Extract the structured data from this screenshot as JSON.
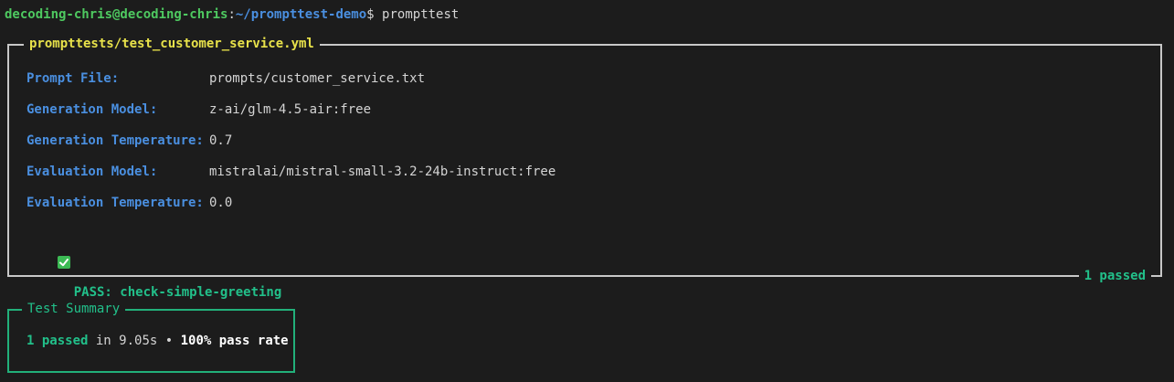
{
  "prompt": {
    "user_host": "decoding-chris@decoding-chris",
    "separator": ":",
    "path": "~/prompttest-demo",
    "symbol": "$",
    "command": "prompttest"
  },
  "test_panel": {
    "title": "prompttests/test_customer_service.yml",
    "fields": [
      {
        "label": "Prompt File:",
        "value": "prompts/customer_service.txt"
      },
      {
        "label": "Generation Model:",
        "value": "z-ai/glm-4.5-air:free"
      },
      {
        "label": "Generation Temperature:",
        "value": "0.7"
      },
      {
        "label": "Evaluation Model:",
        "value": "mistralai/mistral-small-3.2-24b-instruct:free"
      },
      {
        "label": "Evaluation Temperature:",
        "value": "0.0"
      }
    ],
    "result": {
      "icon": "check-mark-icon",
      "text": "PASS: check-simple-greeting"
    },
    "footer": "1 passed"
  },
  "summary_panel": {
    "title": "Test Summary",
    "passed": "1 passed",
    "in_text": " in ",
    "duration": "9.05s",
    "bullet": " • ",
    "rate": "100% pass rate"
  },
  "colors": {
    "background": "#1c1c1c",
    "user": "#4ec960",
    "path": "#4a8fe0",
    "title": "#e8e24a",
    "pass": "#22c08a",
    "panel_border": "#c8c8c8",
    "summary_border": "#22b07a"
  }
}
